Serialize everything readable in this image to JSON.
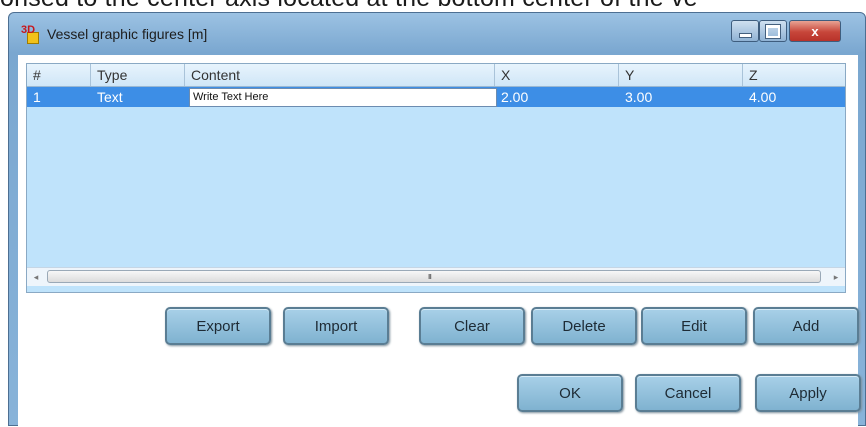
{
  "document": {
    "context_text": "onsed to the center axis located at the bottom center of the ve"
  },
  "window": {
    "app_icon_label": "3D",
    "title": "Vessel graphic figures [m]",
    "controls": {
      "minimize": "minimize-icon",
      "maximize": "maximize-icon",
      "close": "x"
    }
  },
  "table": {
    "headers": [
      "#",
      "Type",
      "Content",
      "X",
      "Y",
      "Z"
    ],
    "rows": [
      {
        "index": "1",
        "type": "Text",
        "content": "Write Text Here",
        "x": "2.00",
        "y": "3.00",
        "z": "4.00"
      }
    ],
    "selection_color": "#3d8ee6",
    "scroll": {
      "left_arrow": "◂",
      "right_arrow": "▸",
      "grip": "III"
    }
  },
  "buttons": {
    "export": "Export",
    "import": "Import",
    "clear": "Clear",
    "delete": "Delete",
    "edit": "Edit",
    "add": "Add",
    "ok": "OK",
    "cancel": "Cancel",
    "apply": "Apply"
  }
}
